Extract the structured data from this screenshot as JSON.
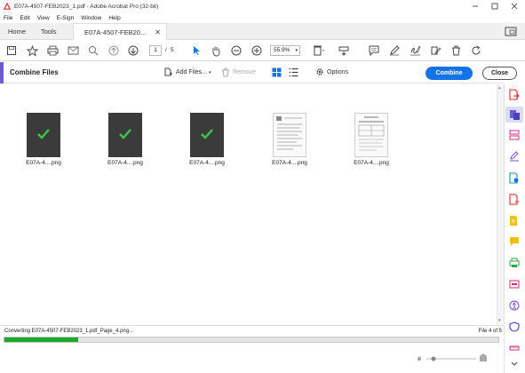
{
  "window": {
    "title": "E07A-4507-FEB2023_1.pdf - Adobe Acrobat Pro (32-bit)"
  },
  "menu": [
    "File",
    "Edit",
    "View",
    "E-Sign",
    "Window",
    "Help"
  ],
  "tabs": {
    "home": "Home",
    "tools": "Tools",
    "document": "E07A-4507-FEB20..."
  },
  "toolbar": {
    "page_current": "1",
    "page_separator": "/",
    "page_total": "5",
    "zoom": "55.9%"
  },
  "combine": {
    "title": "Combine Files",
    "add_files": "Add Files...",
    "remove": "Remove",
    "options": "Options",
    "combine_button": "Combine",
    "close_button": "Close"
  },
  "files": [
    {
      "name": "E07A-4....png",
      "style": "dark",
      "converted": true
    },
    {
      "name": "E07A-4....png",
      "style": "dark",
      "converted": true
    },
    {
      "name": "E07A-4....png",
      "style": "dark",
      "converted": true
    },
    {
      "name": "E07A-4....png",
      "style": "light",
      "converted": false
    },
    {
      "name": "E07A-4....png",
      "style": "light",
      "converted": false
    }
  ],
  "status": {
    "message": "Converting E07A-4507-FEB2023_1.pdf_Page_4.png...",
    "file_count": "File 4 of 5",
    "progress_fraction": 0.15
  },
  "colors": {
    "accent": "#6b5cd6",
    "primary_button": "#1473e6",
    "progress": "#1aa928",
    "check": "#3cc84a"
  }
}
